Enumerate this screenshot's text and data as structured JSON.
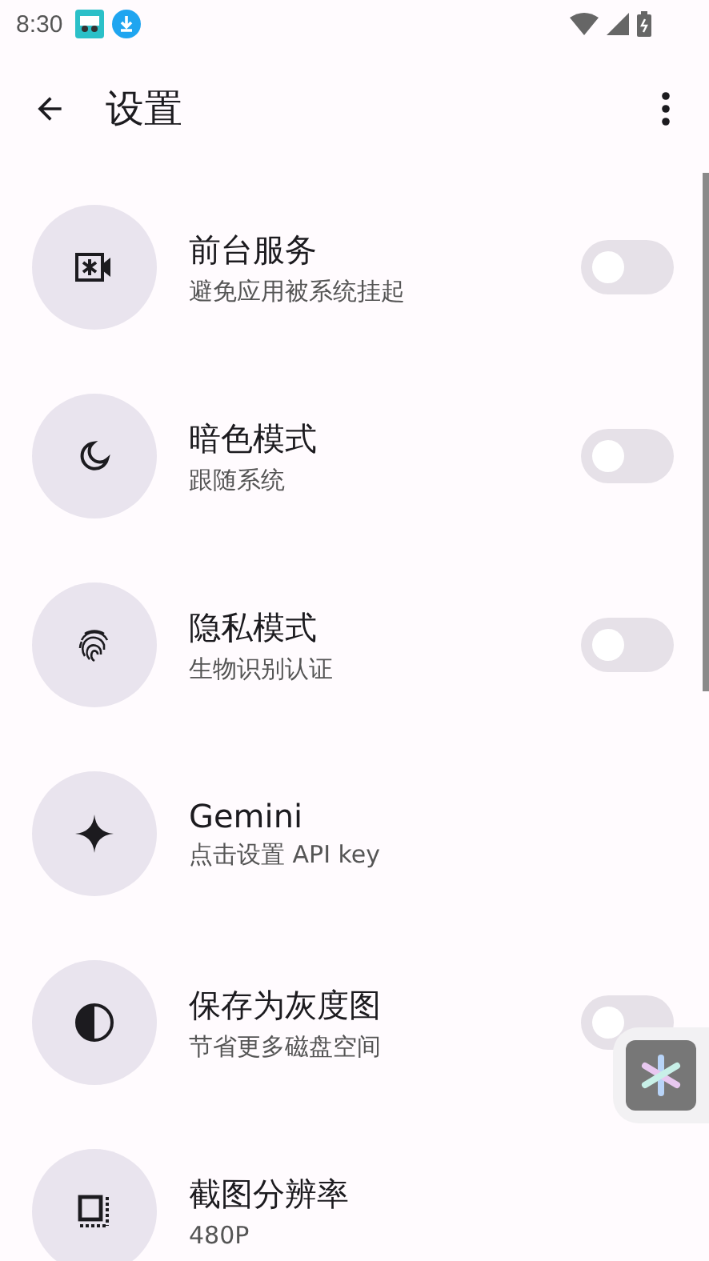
{
  "status_bar": {
    "time": "8:30"
  },
  "app_bar": {
    "title": "设置"
  },
  "settings": [
    {
      "kind": "toggle",
      "title": "前台服务",
      "subtitle": "避免应用被系统挂起",
      "on": false
    },
    {
      "kind": "toggle",
      "title": "暗色模式",
      "subtitle": "跟随系统",
      "on": false
    },
    {
      "kind": "toggle",
      "title": "隐私模式",
      "subtitle": "生物识别认证",
      "on": false
    },
    {
      "kind": "action",
      "title": "Gemini",
      "subtitle": "点击设置 API key"
    },
    {
      "kind": "toggle",
      "title": "保存为灰度图",
      "subtitle": "节省更多磁盘空间",
      "on": false
    },
    {
      "kind": "action",
      "title": "截图分辨率",
      "subtitle": "480P"
    }
  ]
}
